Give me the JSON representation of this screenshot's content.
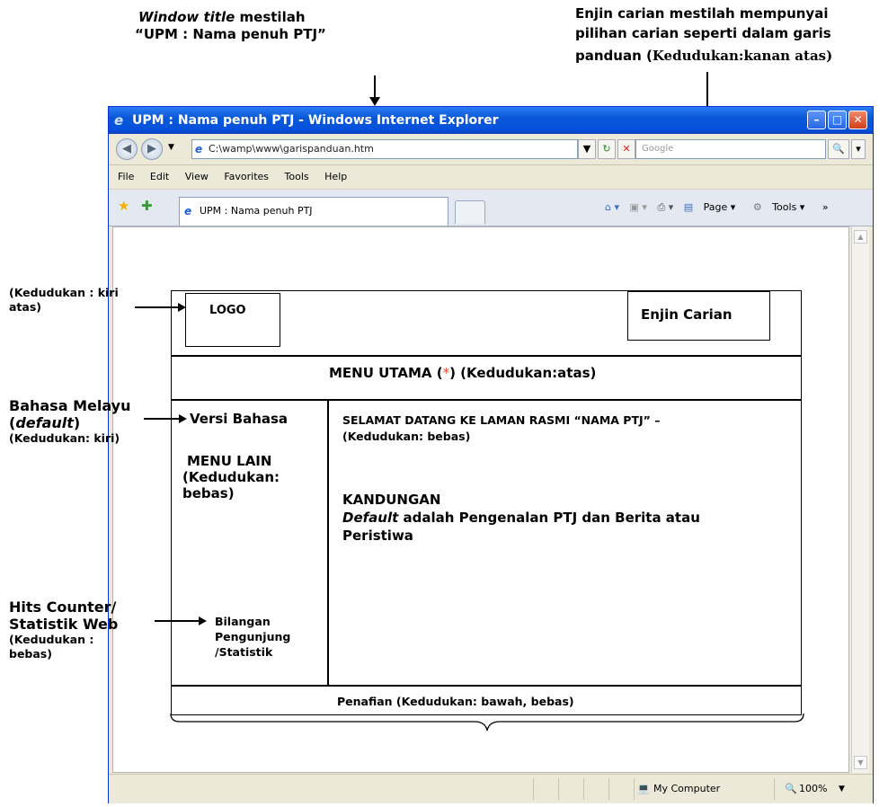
{
  "annotations": {
    "window_title": {
      "italic": "Window title",
      "rest": " mestilah",
      "line2": "“UPM :  Nama penuh PTJ”"
    },
    "search_engine": {
      "line1": "Enjin carian mestilah mempunyai",
      "line2": "pilihan carian seperti dalam garis",
      "line3_a": "panduan (",
      "line3_b": "Kedudukan:kanan atas)"
    },
    "logo_position": {
      "line1": "(Kedudukan : kiri",
      "line2": "atas)"
    },
    "language": {
      "line1": "Bahasa Melayu",
      "line2_a": "(",
      "line2_italic": "default",
      "line2_b": ")",
      "line3": "(Kedudukan: kiri)"
    },
    "counter": {
      "line1": "Hits Counter/",
      "line2": "Statistik Web",
      "line3": "(Kedudukan :",
      "line4": "bebas)"
    }
  },
  "browser": {
    "title": "UPM : Nama penuh PTJ - Windows Internet Explorer",
    "address": "C:\\wamp\\www\\garispanduan.htm",
    "search_placeholder": "Google",
    "menu": [
      "File",
      "Edit",
      "View",
      "Favorites",
      "Tools",
      "Help"
    ],
    "tab_title": "UPM : Nama penuh PTJ",
    "toolbar": {
      "page": "Page ▾",
      "tools": "Tools ▾"
    },
    "status": {
      "computer": "My Computer",
      "zoom": "100%"
    }
  },
  "layout": {
    "logo": "LOGO",
    "search": "Enjin Carian",
    "menu_main_a": "MENU UTAMA (",
    "menu_main_star": "*",
    "menu_main_b": ") (Kedudukan:atas)",
    "version": "Versi Bahasa",
    "other_menu": {
      "l1": "MENU LAIN",
      "l2": "(Kedudukan:",
      "l3": "bebas)"
    },
    "counter": {
      "l1": "Bilangan",
      "l2": "Pengunjung",
      "l3": "/Statistik"
    },
    "welcome": {
      "l1": "SELAMAT DATANG KE LAMAN RASMI “NAMA PTJ” –",
      "l2": "(Kedudukan: bebas)"
    },
    "content": {
      "heading": "KANDUNGAN",
      "l2_italic": "Default",
      "l2_rest": " adalah Pengenalan PTJ dan Berita atau",
      "l3": "Peristiwa"
    },
    "footer": "Penafian (Kedudukan: bawah, bebas)"
  },
  "colors": {
    "star": "#e8452c",
    "titlebar": "#0551dd"
  }
}
